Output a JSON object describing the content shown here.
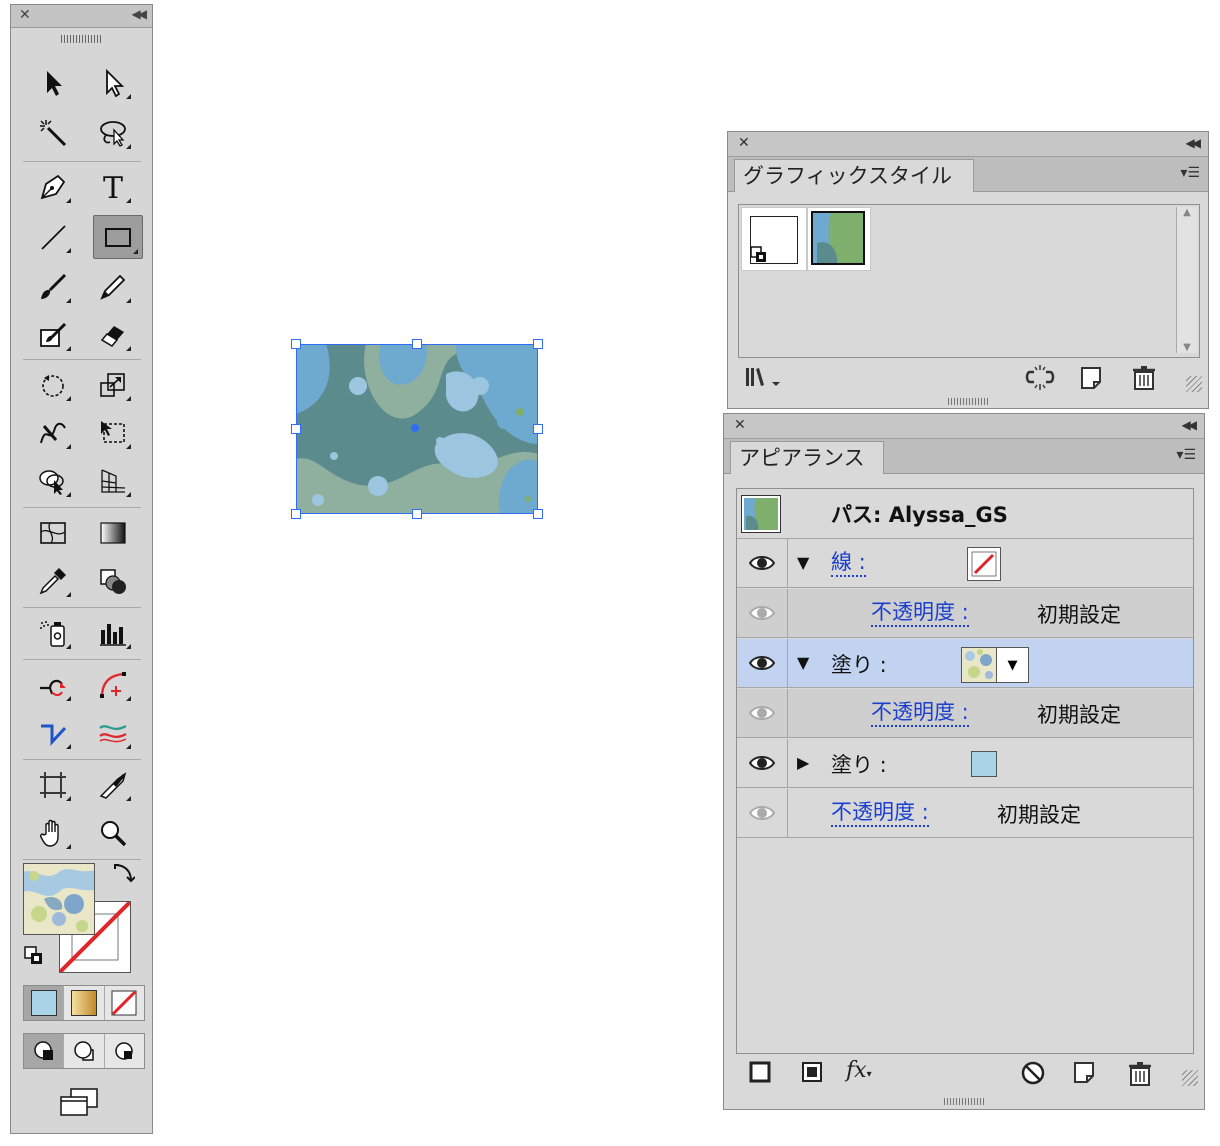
{
  "toolbar": {
    "tools": [
      "selection-tool",
      "direct-selection-tool",
      "magic-wand-tool",
      "lasso-tool",
      "pen-tool",
      "type-tool",
      "line-tool",
      "rectangle-tool",
      "paintbrush-tool",
      "pencil-tool",
      "blob-brush-tool",
      "eraser-tool",
      "rotate-tool",
      "scale-tool",
      "warp-tool",
      "free-transform-tool",
      "shape-builder-tool",
      "perspective-grid-tool",
      "mesh-tool",
      "gradient-tool",
      "eyedropper-tool",
      "blend-tool",
      "symbol-sprayer-tool",
      "column-graph-tool",
      "anchor-point-tool",
      "add-anchor-point-tool",
      "join-tool",
      "width-tool",
      "artboard-tool",
      "slice-tool",
      "hand-tool",
      "zoom-tool"
    ],
    "selected_tool": "rectangle-tool"
  },
  "graphic_styles": {
    "tab": "グラフィックスタイル",
    "styles": [
      "default-style",
      "Alyssa_GS"
    ]
  },
  "appearance": {
    "tab": "アピアランス",
    "header": "パス: Alyssa_GS",
    "rows": [
      {
        "label": "線 :",
        "value": ""
      },
      {
        "label": "不透明度 :",
        "value": "初期設定"
      },
      {
        "label": "塗り :",
        "value": ""
      },
      {
        "label": "不透明度 :",
        "value": "初期設定"
      },
      {
        "label": "塗り :",
        "value": ""
      },
      {
        "label": "不透明度 :",
        "value": "初期設定"
      }
    ],
    "fx_label": "fx"
  },
  "colors": {
    "accent": "#2f6df6",
    "link": "#1a3fcf",
    "highlight_row": "#c2d3f1",
    "pattern_blue": "#6ea9cf",
    "pattern_green": "#8fb09f",
    "pattern_dark": "#5b8b8c",
    "fill_swatch": "#a9d3e6",
    "stroke_none_red": "#e0262a"
  }
}
